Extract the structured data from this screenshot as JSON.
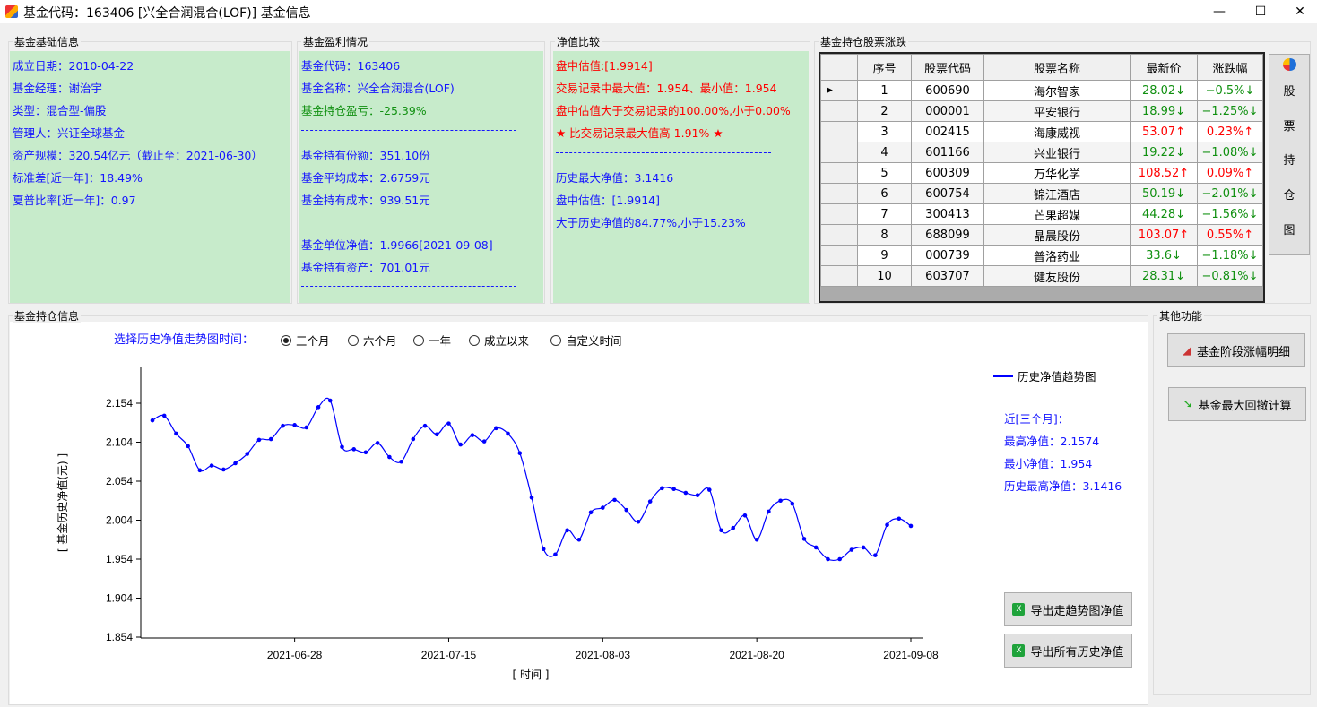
{
  "window": {
    "title": "基金代码：163406 [兴全合润混合(LOF)] 基金信息",
    "minimize": "—",
    "maximize": "☐",
    "close": "✕"
  },
  "basic": {
    "label": "基金基础信息",
    "lines": [
      "成立日期：2010-04-22",
      "基金经理：谢治宇",
      "类型：混合型-偏股",
      "管理人：兴证全球基金",
      "资产规模：320.54亿元（截止至：2021-06-30）",
      "标准差[近一年]：18.49%",
      "夏普比率[近一年]：0.97"
    ]
  },
  "profit": {
    "label": "基金盈利情况",
    "code": "基金代码：163406",
    "name": "基金名称：兴全合润混合(LOF)",
    "pnl": "基金持仓盈亏：-25.39%",
    "shares": "基金持有份额：351.10份",
    "avg_cost": "基金平均成本：2.6759元",
    "total_cost": "基金持有成本：939.51元",
    "nav": "基金单位净值：1.9966[2021-09-08]",
    "assets": "基金持有资产：701.01元"
  },
  "compare": {
    "label": "净值比较",
    "est": "盘中估值:[1.9914]",
    "range": "交易记录中最大值：1.954、最小值：1.954",
    "pct": "盘中估值大于交易记录的100.00%,小于0.00%",
    "star": "★ 比交易记录最大值高 1.91% ★",
    "hist_max": "历史最大净值：3.1416",
    "est2": "盘中估值：[1.9914]",
    "hist_pct": "大于历史净值的84.77%,小于15.23%"
  },
  "holdings": {
    "label": "基金持仓股票涨跌",
    "columns": [
      "序号",
      "股票代码",
      "股票名称",
      "最新价",
      "涨跌幅"
    ],
    "rows": [
      {
        "no": "1",
        "code": "600690",
        "name": "海尔智家",
        "price": "28.02↓",
        "chg": "−0.5%↓",
        "dir": "down"
      },
      {
        "no": "2",
        "code": "000001",
        "name": "平安银行",
        "price": "18.99↓",
        "chg": "−1.25%↓",
        "dir": "down"
      },
      {
        "no": "3",
        "code": "002415",
        "name": "海康威视",
        "price": "53.07↑",
        "chg": "0.23%↑",
        "dir": "up"
      },
      {
        "no": "4",
        "code": "601166",
        "name": "兴业银行",
        "price": "19.22↓",
        "chg": "−1.08%↓",
        "dir": "down"
      },
      {
        "no": "5",
        "code": "600309",
        "name": "万华化学",
        "price": "108.52↑",
        "chg": "0.09%↑",
        "dir": "up"
      },
      {
        "no": "6",
        "code": "600754",
        "name": "锦江酒店",
        "price": "50.19↓",
        "chg": "−2.01%↓",
        "dir": "down"
      },
      {
        "no": "7",
        "code": "300413",
        "name": "芒果超媒",
        "price": "44.28↓",
        "chg": "−1.56%↓",
        "dir": "down"
      },
      {
        "no": "8",
        "code": "688099",
        "name": "晶晨股份",
        "price": "103.07↑",
        "chg": "0.55%↑",
        "dir": "up"
      },
      {
        "no": "9",
        "code": "000739",
        "name": "普洛药业",
        "price": "33.6↓",
        "chg": "−1.18%↓",
        "dir": "down"
      },
      {
        "no": "10",
        "code": "603707",
        "name": "健友股份",
        "price": "28.31↓",
        "chg": "−0.81%↓",
        "dir": "down"
      }
    ],
    "side_button": [
      "股",
      "票",
      "持",
      "仓",
      "图"
    ]
  },
  "position": {
    "label": "基金持仓信息",
    "select_label": "选择历史净值走势图时间：",
    "options": [
      "三个月",
      "六个月",
      "一年",
      "成立以来",
      "自定义时间"
    ],
    "selected": 0,
    "stats": {
      "period": "近[三个月]：",
      "max": "最高净值：2.1574",
      "min": "最小净值：1.954",
      "hist_max": "历史最高净值：3.1416"
    },
    "export_chart": "导出走趋势图净值",
    "export_all": "导出所有历史净值"
  },
  "other": {
    "label": "其他功能",
    "stage_btn": "基金阶段涨幅明细",
    "drawdown_btn": "基金最大回撤计算"
  },
  "colors": {
    "panel_green": "#c7ebcb",
    "text_blue": "#1515ff",
    "up": "#ff0000",
    "down": "#109010",
    "line": "#0000ff"
  },
  "chart_data": {
    "type": "line",
    "xlabel": "[ 时间 ]",
    "ylabel": "[ 基金历史净值(元) ]",
    "legend": "历史净值趋势图",
    "legend_position": "top-right",
    "ylim": [
      1.854,
      2.174
    ],
    "yticks": [
      "1.854",
      "1.904",
      "1.954",
      "2.004",
      "2.054",
      "2.104",
      "2.154"
    ],
    "xticks": [
      "2021-06-28",
      "2021-07-15",
      "2021-08-03",
      "2021-08-20",
      "2021-09-08"
    ],
    "x": [
      "2021-06-09",
      "2021-06-10",
      "2021-06-11",
      "2021-06-15",
      "2021-06-16",
      "2021-06-17",
      "2021-06-18",
      "2021-06-21",
      "2021-06-22",
      "2021-06-23",
      "2021-06-24",
      "2021-06-25",
      "2021-06-28",
      "2021-06-29",
      "2021-06-30",
      "2021-07-01",
      "2021-07-02",
      "2021-07-05",
      "2021-07-06",
      "2021-07-07",
      "2021-07-08",
      "2021-07-09",
      "2021-07-12",
      "2021-07-13",
      "2021-07-14",
      "2021-07-15",
      "2021-07-16",
      "2021-07-19",
      "2021-07-20",
      "2021-07-21",
      "2021-07-22",
      "2021-07-23",
      "2021-07-26",
      "2021-07-27",
      "2021-07-28",
      "2021-07-29",
      "2021-07-30",
      "2021-08-02",
      "2021-08-03",
      "2021-08-04",
      "2021-08-05",
      "2021-08-06",
      "2021-08-09",
      "2021-08-10",
      "2021-08-11",
      "2021-08-12",
      "2021-08-13",
      "2021-08-16",
      "2021-08-17",
      "2021-08-18",
      "2021-08-19",
      "2021-08-20",
      "2021-08-23",
      "2021-08-24",
      "2021-08-25",
      "2021-08-26",
      "2021-08-27",
      "2021-08-30",
      "2021-08-31",
      "2021-09-01",
      "2021-09-02",
      "2021-09-03",
      "2021-09-06",
      "2021-09-07",
      "2021-09-08"
    ],
    "y": [
      2.132,
      2.138,
      2.115,
      2.099,
      2.068,
      2.074,
      2.069,
      2.077,
      2.089,
      2.107,
      2.108,
      2.125,
      2.126,
      2.123,
      2.149,
      2.1574,
      2.098,
      2.095,
      2.091,
      2.103,
      2.085,
      2.079,
      2.108,
      2.125,
      2.114,
      2.128,
      2.101,
      2.113,
      2.105,
      2.122,
      2.115,
      2.09,
      2.033,
      1.967,
      1.96,
      1.991,
      1.979,
      2.014,
      2.02,
      2.03,
      2.017,
      2.002,
      2.028,
      2.045,
      2.044,
      2.039,
      2.036,
      2.043,
      1.991,
      1.994,
      2.01,
      1.979,
      2.015,
      2.029,
      2.025,
      1.98,
      1.969,
      1.954,
      1.954,
      1.966,
      1.969,
      1.959,
      1.998,
      2.006,
      1.9966
    ]
  }
}
